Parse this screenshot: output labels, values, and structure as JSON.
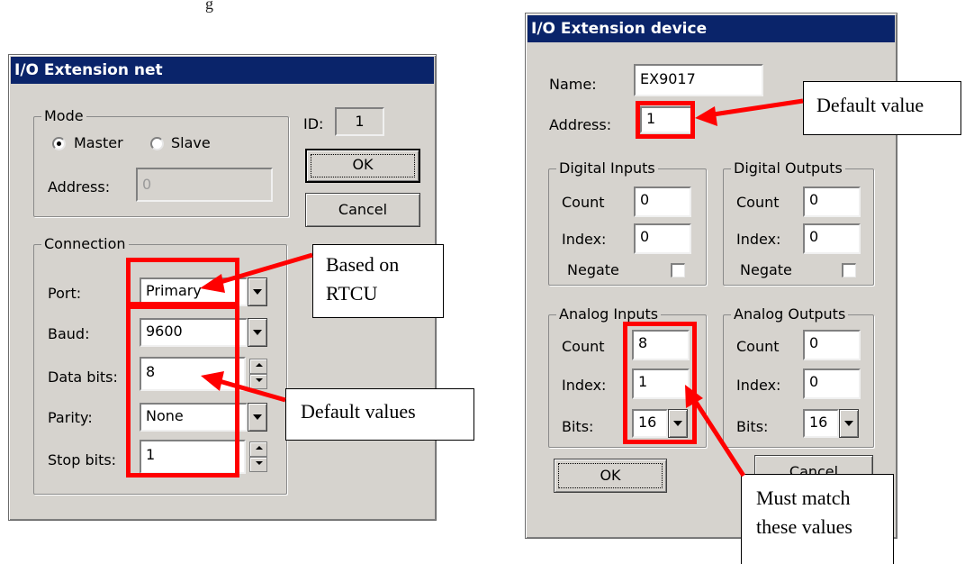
{
  "page_top_fragment": "g",
  "colors": {
    "title_bar": "#0a246a",
    "dialog_bg": "#d6d3ce",
    "annotation_red": "#ff0000"
  },
  "net_dialog": {
    "title": "I/O Extension net",
    "mode": {
      "legend": "Mode",
      "master_label": "Master",
      "slave_label": "Slave",
      "selected": "Master",
      "address_label": "Address:",
      "address_value": "0"
    },
    "id_label": "ID:",
    "id_value": "1",
    "ok_label": "OK",
    "cancel_label": "Cancel",
    "connection": {
      "legend": "Connection",
      "port_label": "Port:",
      "port_value": "Primary",
      "baud_label": "Baud:",
      "baud_value": "9600",
      "data_bits_label": "Data bits:",
      "data_bits_value": "8",
      "parity_label": "Parity:",
      "parity_value": "None",
      "stop_bits_label": "Stop bits:",
      "stop_bits_value": "1"
    }
  },
  "device_dialog": {
    "title": "I/O Extension device",
    "name_label": "Name:",
    "name_value": "EX9017",
    "address_label": "Address:",
    "address_value": "1",
    "digital_inputs": {
      "legend": "Digital Inputs",
      "count_label": "Count",
      "count_value": "0",
      "index_label": "Index:",
      "index_value": "0",
      "negate_label": "Negate"
    },
    "digital_outputs": {
      "legend": "Digital Outputs",
      "count_label": "Count",
      "count_value": "0",
      "index_label": "Index:",
      "index_value": "0",
      "negate_label": "Negate"
    },
    "analog_inputs": {
      "legend": "Analog Inputs",
      "count_label": "Count",
      "count_value": "8",
      "index_label": "Index:",
      "index_value": "1",
      "bits_label": "Bits:",
      "bits_value": "16"
    },
    "analog_outputs": {
      "legend": "Analog Outputs",
      "count_label": "Count",
      "count_value": "0",
      "index_label": "Index:",
      "index_value": "0",
      "bits_label": "Bits:",
      "bits_value": "16"
    },
    "ok_label": "OK",
    "cancel_label": "Cancel"
  },
  "annotations": {
    "based_on_line1": "Based on",
    "based_on_line2": "RTCU",
    "default_values": "Default values",
    "default_value": "Default value",
    "must_match_line1": "Must match",
    "must_match_line2": "these values"
  }
}
